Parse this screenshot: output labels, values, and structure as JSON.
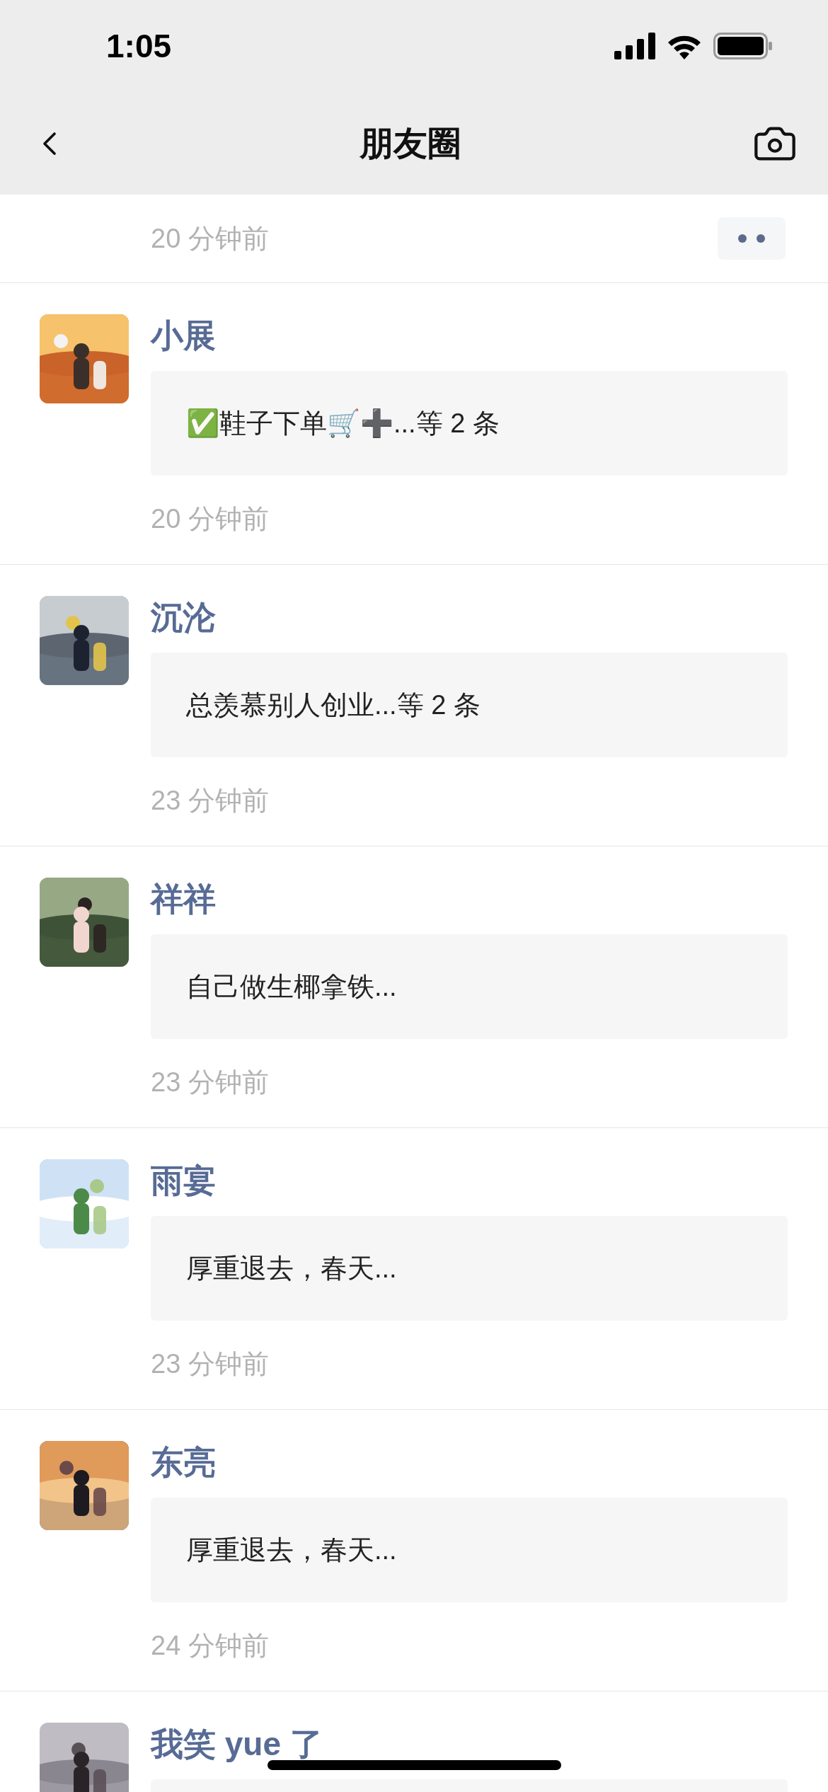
{
  "status_bar": {
    "time": "1:05"
  },
  "nav": {
    "title": "朋友圈"
  },
  "top_entry": {
    "time": "20 分钟前"
  },
  "posts": [
    {
      "name": "小展",
      "preview": "✅鞋子下单🛒➕...等 2 条",
      "time": "20 分钟前"
    },
    {
      "name": "沉沦",
      "preview": "总羡慕别人创业...等 2 条",
      "time": "23 分钟前"
    },
    {
      "name": "祥祥",
      "preview": "自己做生椰拿铁...",
      "time": "23 分钟前"
    },
    {
      "name": "雨宴",
      "preview": "厚重退去，春天...",
      "time": "23 分钟前"
    },
    {
      "name": "东亮",
      "preview": "厚重退去，春天...",
      "time": "24 分钟前"
    },
    {
      "name": "我笑 yue 了"
    }
  ]
}
